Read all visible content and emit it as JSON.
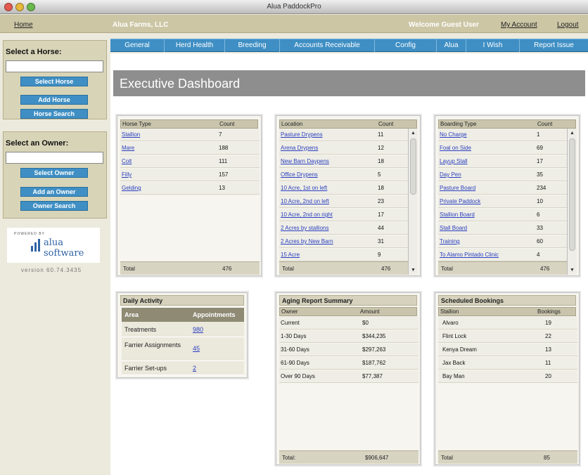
{
  "window": {
    "title": "Alua PaddockPro"
  },
  "topbar": {
    "home": "Home",
    "company": "Alua Farms, LLC",
    "welcome": "Welcome Guest User",
    "my_account": "My Account",
    "logout": "Logout"
  },
  "sidebar": {
    "select_horse_label": "Select a Horse:",
    "select_horse_btn": "Select Horse",
    "add_horse_btn": "Add Horse",
    "horse_search_btn": "Horse Search",
    "select_owner_label": "Select an Owner:",
    "select_owner_btn": "Select Owner",
    "add_owner_btn": "Add an Owner",
    "owner_search_btn": "Owner Search",
    "powered_by": "POWERED BY",
    "logo_text": "alua software",
    "version": "version 60.74.3435"
  },
  "nav": [
    "General",
    "Herd Health",
    "Breeding",
    "Accounts Receivable",
    "Config",
    "Alua",
    "I Wish",
    "Report Issue"
  ],
  "dashboard_title": "Executive Dashboard",
  "horse_type": {
    "col1": "Horse Type",
    "col2": "Count",
    "rows": [
      [
        "Stallion",
        "7"
      ],
      [
        "Mare",
        "188"
      ],
      [
        "Colt",
        "111"
      ],
      [
        "Filly",
        "157"
      ],
      [
        "Gelding",
        "13"
      ]
    ],
    "total_label": "Total",
    "total": "476"
  },
  "location": {
    "col1": "Location",
    "col2": "Count",
    "rows": [
      [
        "Pasture Drypens",
        "11"
      ],
      [
        "Arena Drypens",
        "12"
      ],
      [
        "New Barn Daypens",
        "18"
      ],
      [
        "Office Drypens",
        "5"
      ],
      [
        "10 Acre, 1st on left",
        "18"
      ],
      [
        "10 Acre, 2nd on left",
        "23"
      ],
      [
        "10 Acre, 2nd on right",
        "17"
      ],
      [
        "2 Acres by stallions",
        "44"
      ],
      [
        "2 Acres by New Barn",
        "31"
      ],
      [
        "15 Acre",
        "9"
      ]
    ],
    "total_label": "Total",
    "total": "476"
  },
  "boarding": {
    "col1": "Boarding Type",
    "col2": "Count",
    "rows": [
      [
        "No Charge",
        "1"
      ],
      [
        "Foal on Side",
        "69"
      ],
      [
        "Layup Stall",
        "17"
      ],
      [
        "Day Pen",
        "35"
      ],
      [
        "Pasture Board",
        "234"
      ],
      [
        "Private Paddock",
        "10"
      ],
      [
        "Stallion Board",
        "6"
      ],
      [
        "Stall Board",
        "33"
      ],
      [
        "Training",
        "60"
      ],
      [
        "To Alamo Pintado Clinic",
        "4"
      ]
    ],
    "total_label": "Total",
    "total": "476"
  },
  "daily": {
    "title": "Daily Activity",
    "col1": "Area",
    "col2": "Appointments",
    "rows": [
      [
        "Treatments",
        "980"
      ],
      [
        "Farrier Assignments",
        "45"
      ],
      [
        "Farrier Set-ups",
        "2"
      ]
    ]
  },
  "aging": {
    "title": "Aging Report Summary",
    "col1": "Owner",
    "col2": "Amount",
    "rows": [
      [
        "Current",
        "$0"
      ],
      [
        "1-30 Days",
        "$344,235"
      ],
      [
        "31-60 Days",
        "$297,263"
      ],
      [
        "61-90 Days",
        "$187,762"
      ],
      [
        "Over 90 Days",
        "$77,387"
      ]
    ],
    "total_label": "Total:",
    "total": "$906,647"
  },
  "bookings": {
    "title": "Scheduled Bookings",
    "col1": "Stallion",
    "col2": "Bookings",
    "rows": [
      [
        "Alvaro",
        "19"
      ],
      [
        "Flint Lock",
        "22"
      ],
      [
        "Kenya Dream",
        "13"
      ],
      [
        "Jax Back",
        "11"
      ],
      [
        "Bay Man",
        "20"
      ]
    ],
    "total_label": "Total",
    "total": "85"
  },
  "colors": {
    "nav_blue": "#3f8fc4",
    "topbar": "#ccc6a5",
    "dash_header": "#8e8e8e"
  },
  "icons": {
    "scroll_up": "▲",
    "scroll_down": "▼"
  }
}
